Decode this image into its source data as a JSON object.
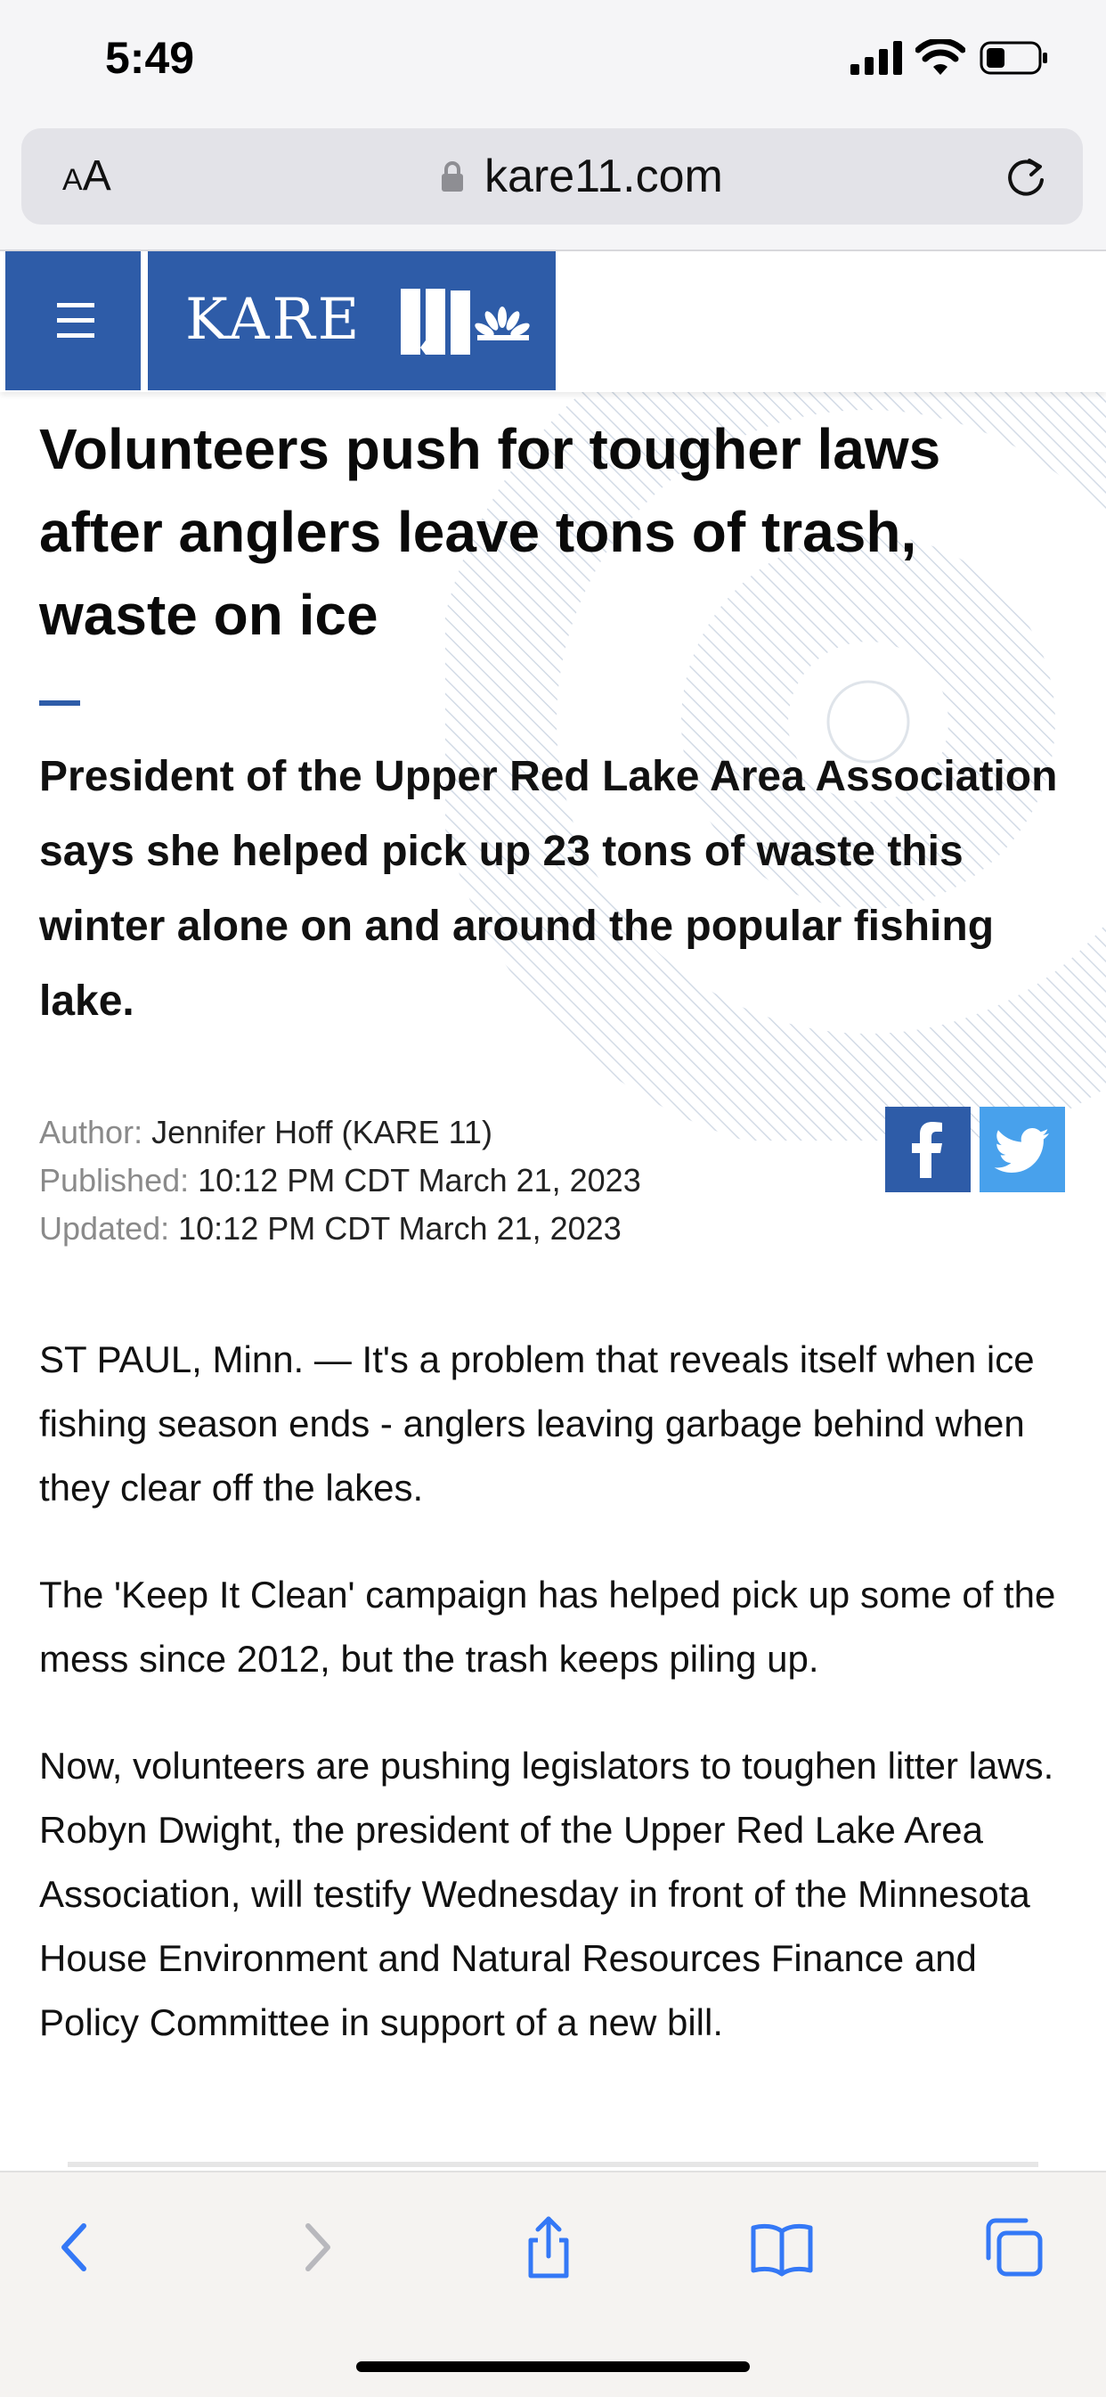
{
  "status_bar": {
    "time": "5:49"
  },
  "browser": {
    "text_size_label_small": "A",
    "text_size_label_large": "A",
    "url": "kare11.com"
  },
  "site": {
    "logo_text": "KARE"
  },
  "article": {
    "headline": "Volunteers push for tougher laws after anglers leave tons of trash, waste on ice",
    "subheadline": "President of the Upper Red Lake Area Association says she helped pick up 23 tons of waste this winter alone on and around the popular fishing lake.",
    "author_label": "Author:",
    "author": "Jennifer Hoff (KARE 11)",
    "published_label": "Published:",
    "published": "10:12 PM CDT March 21, 2023",
    "updated_label": "Updated:",
    "updated": "10:12 PM CDT March 21, 2023",
    "paragraphs": [
      "ST PAUL, Minn. — It's a problem that reveals itself when ice fishing season ends - anglers leaving garbage behind when they clear off the lakes.",
      "The 'Keep It Clean' campaign has helped pick up some of the mess since 2012, but the trash keeps piling up.",
      "Now, volunteers are pushing legislators to toughen litter laws. Robyn Dwight, the president of the Upper Red Lake Area Association, will testify Wednesday in front of the Minnesota House Environment and Natural Resources Finance and Policy Committee in support of a new bill."
    ]
  },
  "icons": {
    "share_facebook": "facebook-icon",
    "share_twitter": "twitter-icon",
    "toolbar": [
      "back-icon",
      "forward-icon",
      "share-icon",
      "bookmarks-icon",
      "tabs-icon"
    ]
  },
  "colors": {
    "brand_blue": "#2e5ca8",
    "twitter_blue": "#48a1ec",
    "toolbar_blue": "#3478f6"
  }
}
